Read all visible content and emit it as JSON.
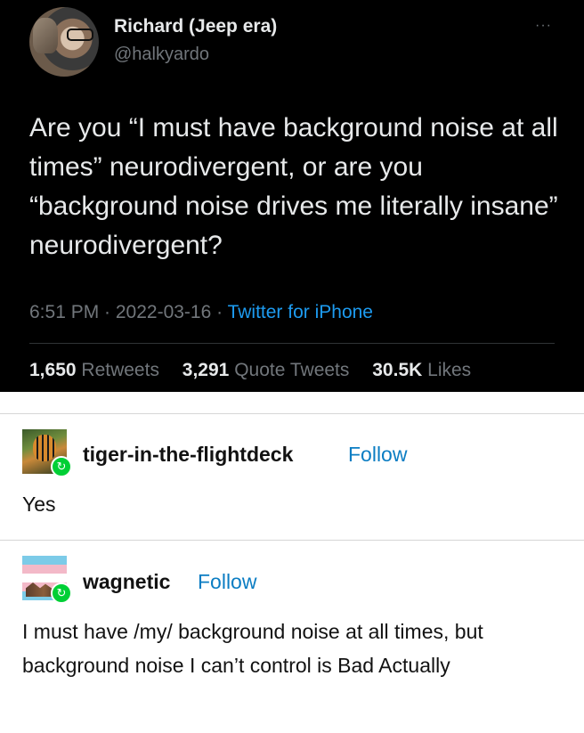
{
  "tweet": {
    "name": "Richard (Jeep era)",
    "handle": "@halkyardo",
    "more_icon": "···",
    "text": "Are you “I must have background noise at all times” neurodivergent, or are you “background noise drives me literally insane” neurodivergent?",
    "time": "6:51 PM · 2022-03-16 · ",
    "source": "Twitter for iPhone",
    "retweets_count": "1,650",
    "retweets_label": "Retweets",
    "quotes_count": "3,291",
    "quotes_label": "Quote Tweets",
    "likes_count": "30.5K",
    "likes_label": "Likes"
  },
  "reblogs": [
    {
      "username": "tiger-in-the-flightdeck",
      "follow": "Follow",
      "text": "Yes"
    },
    {
      "username": "wagnetic",
      "follow": "Follow",
      "text": "I must have /my/ background noise at all times, but background noise I can’t control is Bad Actually"
    }
  ],
  "colors": {
    "twitter_blue": "#1d9bf0",
    "tumblr_follow": "#0b7dc3",
    "reblog_green": "#00cf35"
  }
}
